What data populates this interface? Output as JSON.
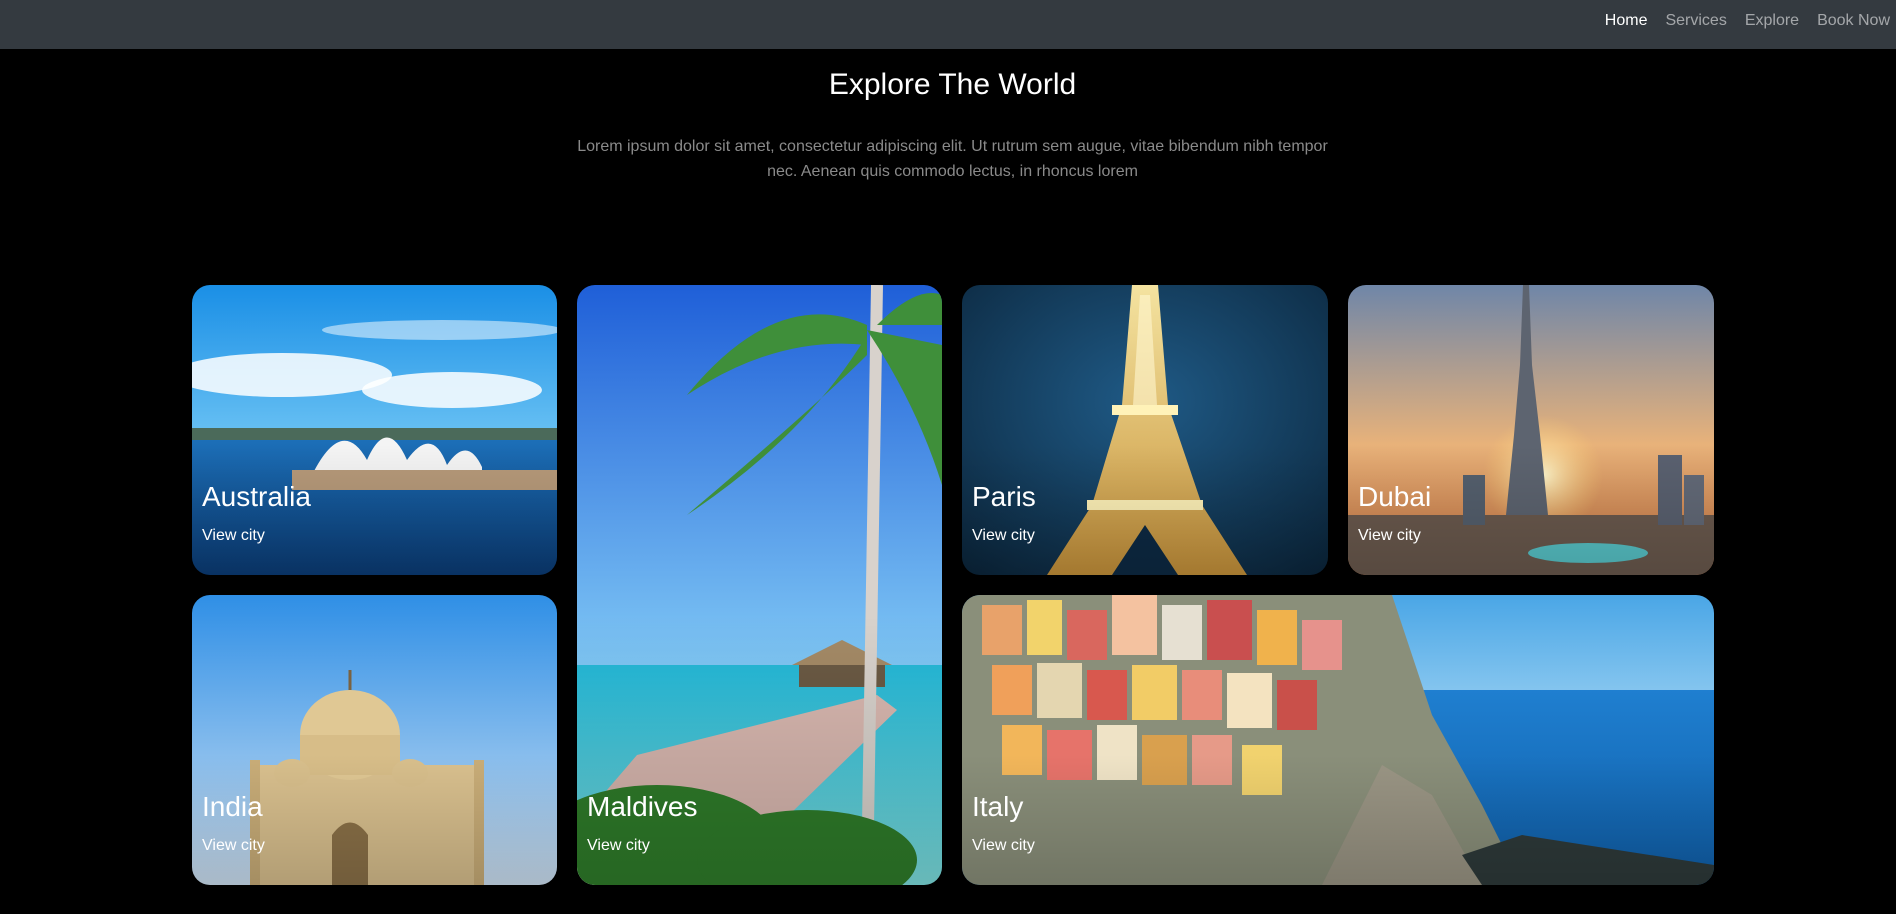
{
  "nav": {
    "items": [
      "Home",
      "Services",
      "Explore",
      "Book Now"
    ]
  },
  "hero": {
    "title": "Explore The World",
    "text": "Lorem ipsum dolor sit amet, consectetur adipiscing elit. Ut rutrum sem augue, vitae bibendum nibh tempor nec. Aenean quis commodo lectus, in rhoncus lorem"
  },
  "cards": [
    {
      "name": "Australia",
      "link": "View city"
    },
    {
      "name": "Maldives",
      "link": "View city"
    },
    {
      "name": "Paris",
      "link": "View city"
    },
    {
      "name": "Dubai",
      "link": "View city"
    },
    {
      "name": "India",
      "link": "View city"
    },
    {
      "name": "Italy",
      "link": "View city"
    }
  ],
  "colors": {
    "navbar_bg": "#343a40",
    "page_bg": "#000000"
  }
}
